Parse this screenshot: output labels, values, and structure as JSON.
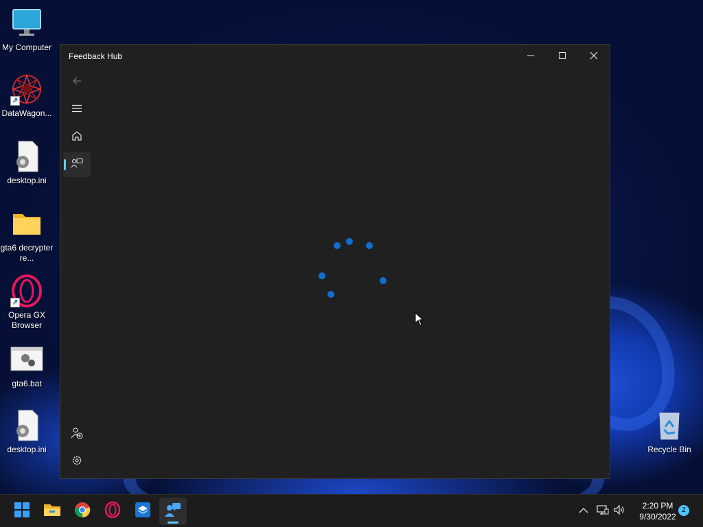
{
  "desktop": {
    "icons": [
      {
        "label": "My Computer",
        "icon": "monitor-icon"
      },
      {
        "label": "DataWagon...",
        "icon": "datawagon-icon"
      },
      {
        "label": "desktop.ini",
        "icon": "settings-file-icon"
      },
      {
        "label": "gta6 decrypter re...",
        "icon": "folder-icon"
      },
      {
        "label": "Opera GX Browser",
        "icon": "opera-gx-icon"
      },
      {
        "label": "gta6.bat",
        "icon": "batch-file-icon"
      },
      {
        "label": "desktop.ini",
        "icon": "settings-file-icon"
      },
      {
        "label": "Recycle Bin",
        "icon": "recycle-bin-icon"
      }
    ]
  },
  "window": {
    "title": "Feedback Hub",
    "controls": [
      "minimize-icon",
      "maximize-icon",
      "close-icon"
    ],
    "nav": [
      "back-arrow-icon",
      "hamburger-menu-icon",
      "home-icon",
      "feedback-icon",
      "add-user-icon",
      "settings-gear-icon"
    ],
    "selected_nav": "feedback-icon",
    "loading": true
  },
  "taskbar": {
    "apps": [
      "windows-start-icon",
      "file-explorer-icon",
      "chrome-icon",
      "opera-icon",
      "mail-app-icon",
      "feedback-hub-icon"
    ],
    "active_app": "feedback-hub-icon",
    "tray": [
      "chevron-up-icon",
      "network-icon",
      "volume-icon"
    ],
    "time": "2:20 PM",
    "date": "9/30/2022",
    "notification_count": "2"
  },
  "colors": {
    "accent": "#60cdff",
    "spinner": "#0f6fd0",
    "window_bg": "#202020"
  }
}
